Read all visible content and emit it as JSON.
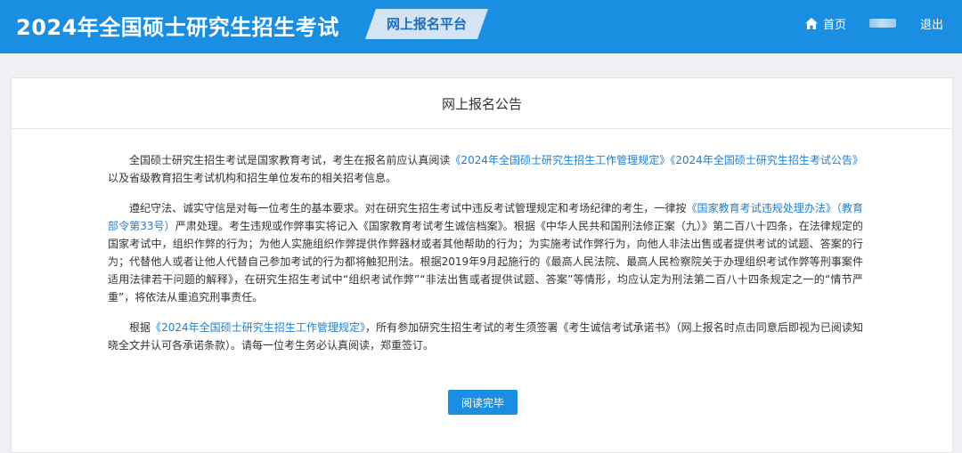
{
  "header": {
    "site_title": "2024年全国硕士研究生招生考试",
    "platform_label": "网上报名平台",
    "nav": {
      "home_label": "首页",
      "logout_label": "退出"
    }
  },
  "notice": {
    "title": "网上报名公告",
    "para1": {
      "t1": "全国硕士研究生招生考试是国家教育考试，考生在报名前应认真阅读",
      "link1": "《2024年全国硕士研究生招生工作管理规定》",
      "link2": "《2024年全国硕士研究生招生考试公告》",
      "t2": "以及省级教育招生考试机构和招生单位发布的相关招考信息。"
    },
    "para2": {
      "t1": "遵纪守法、诚实守信是对每一位考生的基本要求。对在研究生招生考试中违反考试管理规定和考场纪律的考生，一律按",
      "link1": "《国家教育考试违规处理办法》（教育部令第33号）",
      "t2": "严肃处理。考生违规或作弊事实将记入《国家教育考试考生诚信档案》。根据《中华人民共和国刑法修正案（九）》第二百八十四条，在法律规定的国家考试中，组织作弊的行为；为他人实施组织作弊提供作弊器材或者其他帮助的行为；为实施考试作弊行为，向他人非法出售或者提供考试的试题、答案的行为；代替他人或者让他人代替自己参加考试的行为都将触犯刑法。根据2019年9月起施行的《最高人民法院、最高人民检察院关于办理组织考试作弊等刑事案件适用法律若干问题的解释》，在研究生招生考试中“组织考试作弊”“非法出售或者提供试题、答案”等情形，均应认定为刑法第二百八十四条规定之一的“情节严重”，将依法从重追究刑事责任。"
    },
    "para3": {
      "t1": "根据",
      "link1": "《2024年全国硕士研究生招生工作管理规定》",
      "t2": "，所有参加研究生招生考试的考生须签署《考生诚信考试承诺书》（网上报名时点击同意后即视为已阅读知晓全文并认可各承诺条款）。请每一位考生务必认真阅读，郑重签订。"
    },
    "button_label": "阅读完毕"
  },
  "icons": {
    "home": "home-icon"
  },
  "colors": {
    "header_bg": "#1a8ee1",
    "badge_bg": "#d4e4f4",
    "badge_text": "#1a6fbf",
    "link": "#1e7fd0",
    "button_bg": "#1a8ee1",
    "page_bg": "#eef0f3"
  }
}
